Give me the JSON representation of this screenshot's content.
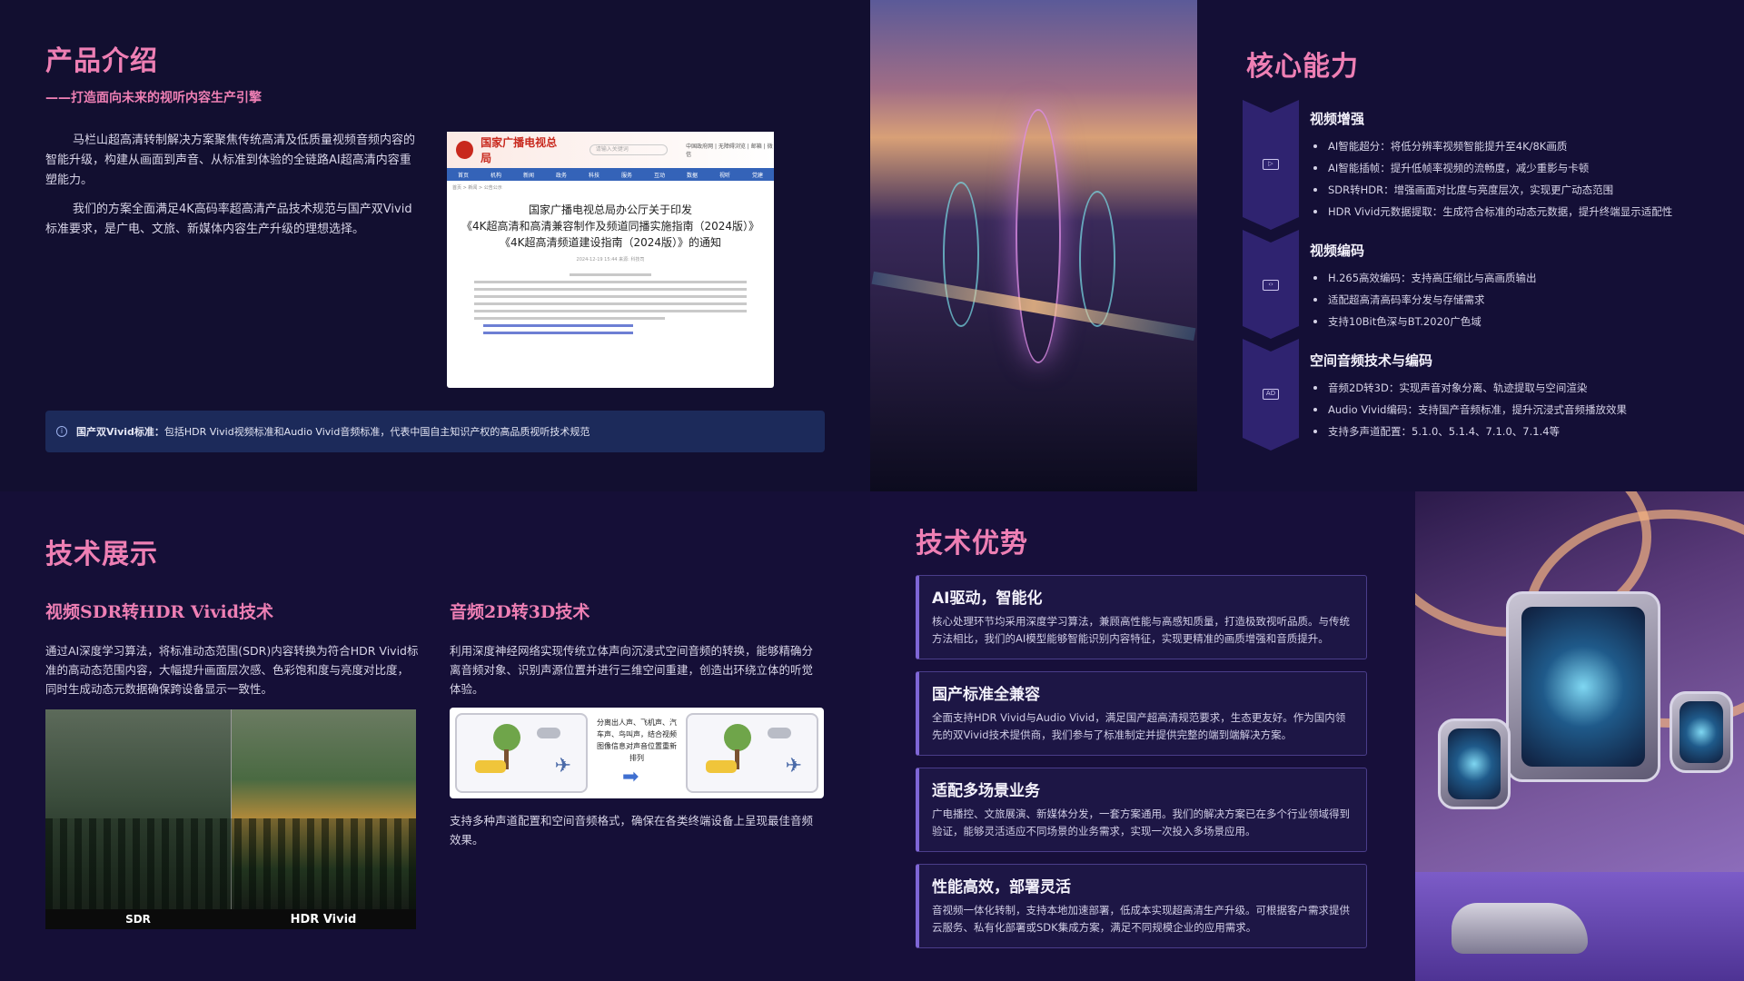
{
  "intro": {
    "title": "产品介绍",
    "subtitle": "——打造面向未来的视听内容生产引擎",
    "para1": "马栏山超高清转制解决方案聚焦传统高清及低质量视频音频内容的智能升级，构建从画面到声音、从标准到体验的全链路AI超高清内容重塑能力。",
    "para2": "我们的方案全面满足4K高码率超高清产品技术规范与国产双Vivid标准要求，是广电、文旅、新媒体内容生产升级的理想选择。",
    "doc": {
      "brand": "国家广播电视总局",
      "search_placeholder": "请输入关键词",
      "top_links": "中国政府网 | 无障碍浏览 | 邮箱 | 微信",
      "nav": [
        "首页",
        "机构",
        "新闻",
        "政务",
        "科技",
        "服务",
        "互动",
        "数据",
        "视听",
        "党建"
      ],
      "breadcrumb": "首页 > 新闻 > 公告公示",
      "title_line1": "国家广播电视总局办公厅关于印发",
      "title_line2": "《4K超高清和高清兼容制作及频道同播实施指南（2024版）》",
      "title_line3": "《4K超高清频道建设指南（2024版）》的通知",
      "meta": "2024-12-19 15:44  来源: 科技司"
    },
    "notice": {
      "label": "国产双Vivid标准：",
      "text": "包括HDR Vivid视频标准和Audio Vivid音频标准，代表中国自主知识产权的高品质视听技术规范"
    }
  },
  "core": {
    "title": "核心能力",
    "groups": [
      {
        "icon": "video-camera-icon",
        "title": "视频增强",
        "items": [
          "AI智能超分：将低分辨率视频智能提升至4K/8K画质",
          "AI智能插帧：提升低帧率视频的流畅度，减少重影与卡顿",
          "SDR转HDR：增强画面对比度与亮度层次，实现更广动态范围",
          "HDR Vivid元数据提取：生成符合标准的动态元数据，提升终端显示适配性"
        ]
      },
      {
        "icon": "code-screen-icon",
        "title": "视频编码",
        "items": [
          "H.265高效编码：支持高压缩比与高画质输出",
          "适配超高清高码率分发与存储需求",
          "支持10Bit色深与BT.2020广色域"
        ]
      },
      {
        "icon": "audio-description-icon",
        "title": "空间音频技术与编码",
        "items": [
          "音频2D转3D：实现声音对象分离、轨迹提取与空间渲染",
          "Audio Vivid编码：支持国产音频标准，提升沉浸式音频播放效果",
          "支持多声道配置：5.1.0、5.1.4、7.1.0、7.1.4等"
        ]
      }
    ]
  },
  "tech": {
    "title": "技术展示",
    "video": {
      "title": "视频SDR转HDR Vivid技术",
      "text": "通过AI深度学习算法，将标准动态范围(SDR)内容转换为符合HDR Vivid标准的高动态范围内容，大幅提升画面层次感、色彩饱和度与亮度对比度，同时生成动态元数据确保跨设备显示一致性。",
      "label_sdr": "SDR",
      "label_hdr": "HDR Vivid"
    },
    "audio": {
      "title": "音频2D转3D技术",
      "text": "利用深度神经网络实现传统立体声向沉浸式空间音频的转换，能够精确分离音频对象、识别声源位置并进行三维空间重建，创造出环绕立体的听觉体验。",
      "diagram_text": "分离出人声、飞机声、汽车声、鸟叫声，结合视频图像信息对声音位置重新排列",
      "note": "支持多种声道配置和空间音频格式，确保在各类终端设备上呈现最佳音频效果。"
    }
  },
  "advantages": {
    "title": "技术优势",
    "items": [
      {
        "title": "AI驱动，智能化",
        "text": "核心处理环节均采用深度学习算法，兼顾高性能与高感知质量，打造极致视听品质。与传统方法相比，我们的AI模型能够智能识别内容特征，实现更精准的画质增强和音质提升。"
      },
      {
        "title": "国产标准全兼容",
        "text": "全面支持HDR Vivid与Audio Vivid，满足国产超高清规范要求，生态更友好。作为国内领先的双Vivid技术提供商，我们参与了标准制定并提供完整的端到端解决方案。"
      },
      {
        "title": "适配多场景业务",
        "text": "广电播控、文旅展演、新媒体分发，一套方案通用。我们的解决方案已在多个行业领域得到验证，能够灵活适应不同场景的业务需求，实现一次投入多场景应用。"
      },
      {
        "title": "性能高效，部署灵活",
        "text": "音视频一体化转制，支持本地加速部署，低成本实现超高清生产升级。可根据客户需求提供云服务、私有化部署或SDK集成方案，满足不同规模企业的应用需求。"
      }
    ]
  }
}
